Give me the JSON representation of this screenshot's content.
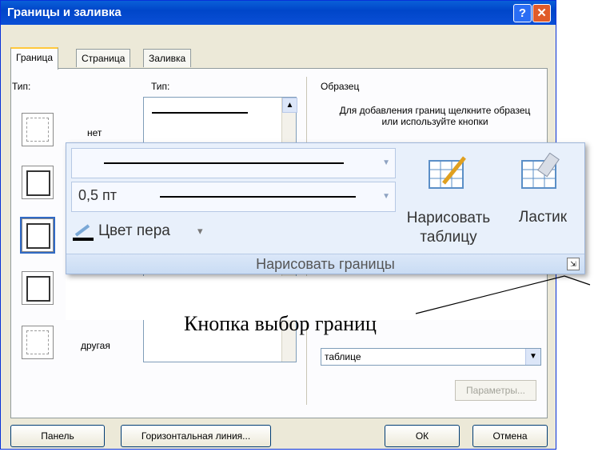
{
  "dialog": {
    "title": "Границы и заливка",
    "help_glyph": "?",
    "close_glyph": "✕",
    "tabs": [
      {
        "label": "Граница",
        "active": true
      },
      {
        "label": "Страница",
        "active": false
      },
      {
        "label": "Заливка",
        "active": false
      }
    ],
    "type_label_left": "Тип:",
    "presets": [
      {
        "label": "нет"
      },
      {
        "label": ""
      },
      {
        "label": ""
      },
      {
        "label": ""
      },
      {
        "label": "другая"
      }
    ],
    "type_label_mid": "Тип:",
    "sample_label": "Образец",
    "sample_hint": "Для добавления границ щелкните образец или используйте кнопки",
    "apply_value": "таблице",
    "params_button": "Параметры...",
    "bottom_buttons": {
      "panel": "Панель",
      "hline": "Горизонтальная линия...",
      "ok": "ОК",
      "cancel": "Отмена"
    }
  },
  "ribbon": {
    "line_width": "0,5 пт",
    "pen_color": "Цвет пера",
    "pen_caret": "▾",
    "draw_table": "Нарисовать таблицу",
    "eraser": "Ластик",
    "group_title": "Нарисовать границы",
    "launcher_glyph": "⇲"
  },
  "annotation": {
    "caption": "Кнопка выбор границ"
  },
  "colors": {
    "titlebar": "#0a5fd8",
    "dialog_bg": "#ece9d8",
    "ribbon_bg": "#e8f0fb",
    "selected_preset": "#316ac5"
  }
}
